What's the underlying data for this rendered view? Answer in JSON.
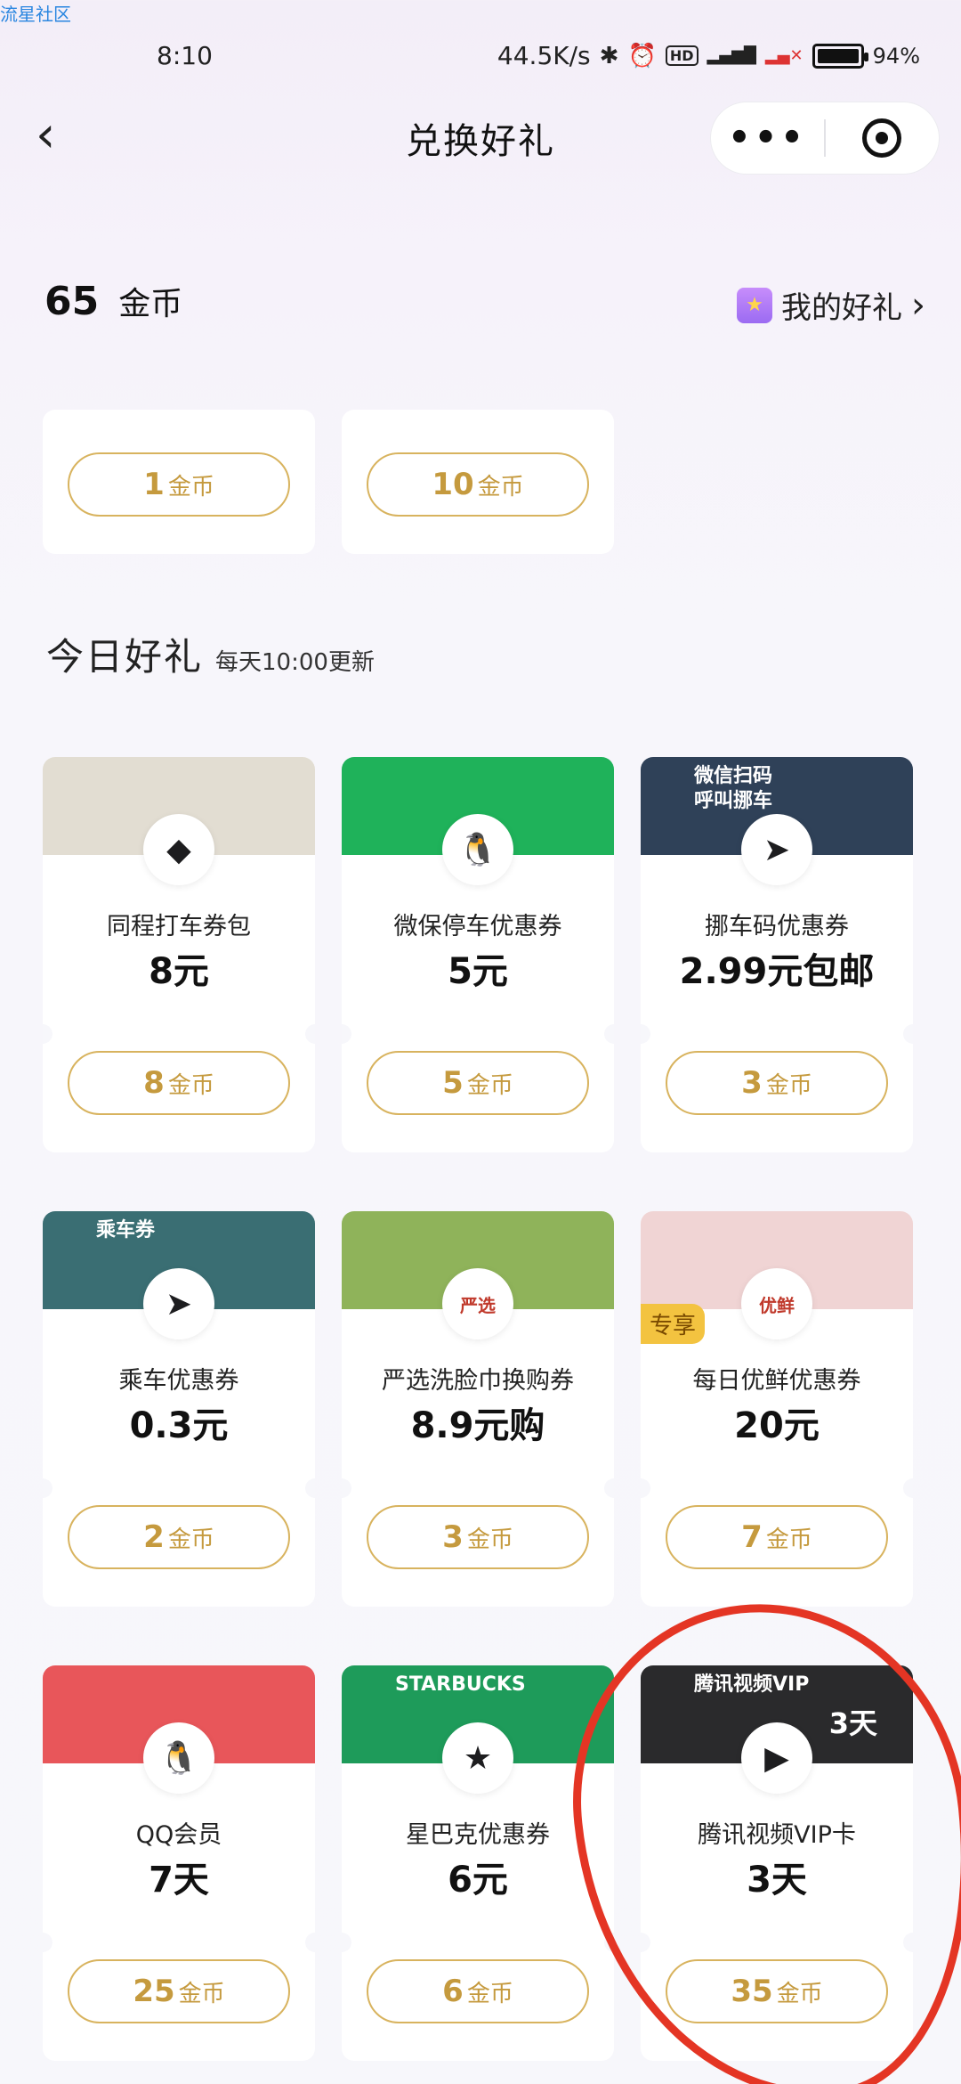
{
  "watermark": "流星社区",
  "status": {
    "time": "8:10",
    "speed": "44.5K/s",
    "battery": "94%"
  },
  "nav": {
    "title": "兑换好礼",
    "more": "•••"
  },
  "header": {
    "coins_value": "65",
    "coins_unit": "金币",
    "my_gifts": "我的好礼",
    "my_gifts_arrow": "›"
  },
  "top_row": [
    {
      "price": "1",
      "unit": "金币"
    },
    {
      "price": "10",
      "unit": "金币"
    }
  ],
  "section": {
    "title": "今日好礼",
    "subtitle": "每天10:00更新"
  },
  "cards": [
    {
      "name": "同程打车券包",
      "value": "8元",
      "price": "8",
      "unit": "金币",
      "top_color": "#e2ddd2",
      "icon": "tongcheng-logo-icon",
      "glyph": "◆"
    },
    {
      "name": "微保停车优惠券",
      "value": "5元",
      "price": "5",
      "unit": "金币",
      "top_color": "#1fb25a",
      "icon": "weibao-penguin-icon",
      "glyph": "🐧"
    },
    {
      "name": "挪车码优惠券",
      "value": "2.99元包邮",
      "price": "3",
      "unit": "金币",
      "top_color": "#2f4158",
      "icon": "navigation-arrow-icon",
      "glyph": "➤",
      "banner": "微信扫码\n呼叫挪车"
    },
    {
      "name": "乘车优惠券",
      "value": "0.3元",
      "price": "2",
      "unit": "金币",
      "top_color": "#3a6e73",
      "icon": "navigation-arrow-icon",
      "glyph": "➤",
      "banner": "乘车券"
    },
    {
      "name": "严选洗脸巾换购券",
      "value": "8.9元购",
      "price": "3",
      "unit": "金币",
      "top_color": "#8fb35a",
      "icon": "yanxuan-logo-icon",
      "glyph": "严选"
    },
    {
      "name": "每日优鲜优惠券",
      "value": "20元",
      "price": "7",
      "unit": "金币",
      "top_color": "#f0d4d4",
      "icon": "missfresh-logo-icon",
      "glyph": "优鲜",
      "badge": "专享"
    },
    {
      "name": "QQ会员",
      "value": "7天",
      "price": "25",
      "unit": "金币",
      "top_color": "#e8565a",
      "icon": "qq-penguin-icon",
      "glyph": "🐧"
    },
    {
      "name": "星巴克优惠券",
      "value": "6元",
      "price": "6",
      "unit": "金币",
      "top_color": "#1e9b5a",
      "icon": "starbucks-logo-icon",
      "glyph": "★",
      "banner": "STARBUCKS"
    },
    {
      "name": "腾讯视频VIP卡",
      "value": "3天",
      "price": "35",
      "unit": "金币",
      "top_color": "#2a2a2c",
      "icon": "tencent-video-icon",
      "glyph": "▶",
      "banner": "腾讯视频VIP",
      "banner_extra": "3天"
    }
  ]
}
